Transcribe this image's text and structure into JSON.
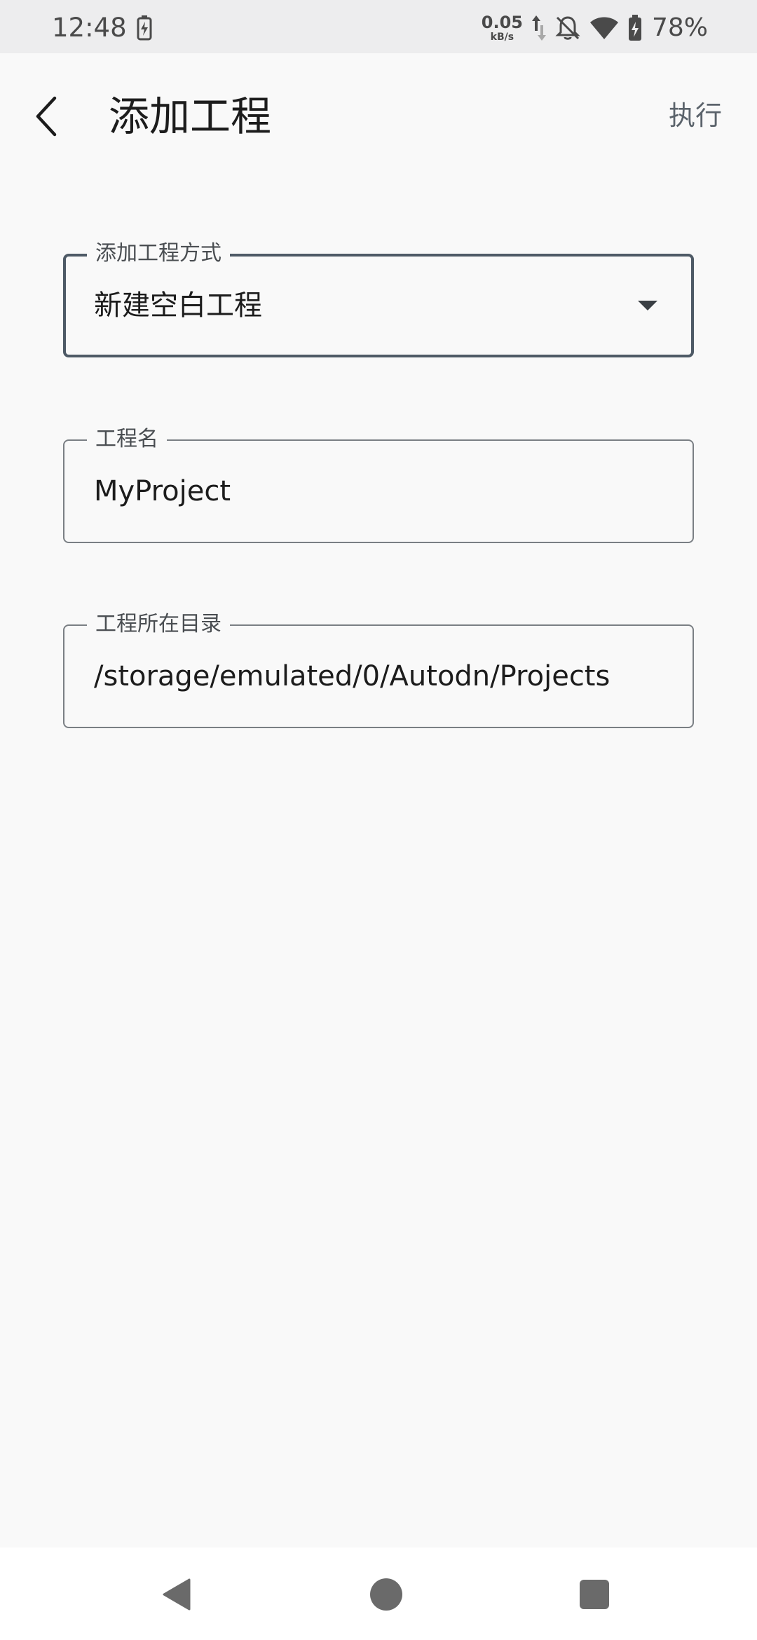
{
  "status_bar": {
    "time": "12:48",
    "net_speed_value": "0.05",
    "net_speed_unit": "kB/s",
    "battery_percent": "78%"
  },
  "app_bar": {
    "title": "添加工程",
    "action_label": "执行"
  },
  "form": {
    "method": {
      "label": "添加工程方式",
      "value": "新建空白工程"
    },
    "name": {
      "label": "工程名",
      "value": "MyProject"
    },
    "directory": {
      "label": "工程所在目录",
      "value": "/storage/emulated/0/Autodn/Projects"
    }
  },
  "icons": {
    "back": "arrow-back-icon",
    "dropdown": "dropdown-arrow-icon",
    "nav_back": "triangle-back-icon",
    "nav_home": "circle-home-icon",
    "nav_recents": "square-recents-icon"
  },
  "colors": {
    "background": "#f9f9f9",
    "status_bar": "#ededee",
    "focused_outline": "#4e5a66",
    "outline": "#7a7f84",
    "action_text": "#5b636b"
  }
}
